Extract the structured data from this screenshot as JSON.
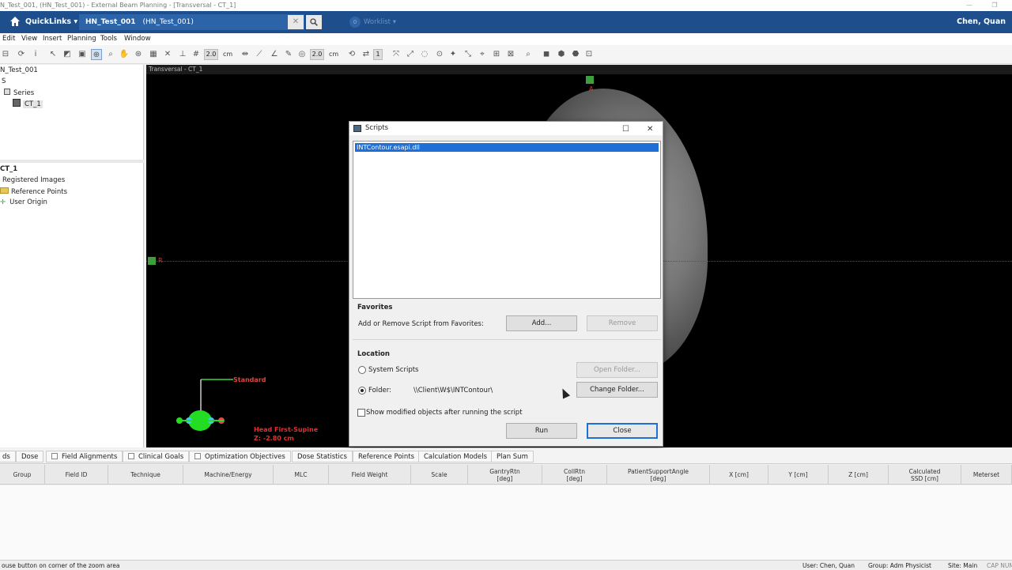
{
  "window": {
    "title": "N_Test_001, (HN_Test_001) - External Beam Planning - [Transversal - CT_1]",
    "controls": [
      "—",
      "❐"
    ]
  },
  "appbar": {
    "quicklinks": "QuickLinks ▾",
    "patient_tab_bold": "HN_Test_001",
    "patient_tab_sub": "(HN_Test_001)",
    "close_glyph": "✕",
    "search_glyph": "🔍",
    "worklist_count": "0",
    "worklist_label": "Worklist ▾",
    "user": "Chen, Quan"
  },
  "menu": [
    "Edit",
    "View",
    "Insert",
    "Planning",
    "Tools",
    "Window"
  ],
  "toolbar": {
    "field1": "2.0",
    "unit1": "cm",
    "field2": "2.0",
    "unit2": "cm",
    "field3": "1"
  },
  "left_panel": {
    "top_items": [
      "N_Test_001",
      "S",
      "Series",
      "CT_1"
    ],
    "bottom_items": [
      "CT_1",
      "Registered Images",
      "Reference Points",
      "User Origin"
    ]
  },
  "viewer": {
    "header": "Transversal - CT_1",
    "label_a": "A",
    "label_r": "R",
    "standard": "Standard",
    "head_first": "Head First-Supine",
    "z_value": "Z: -2.80 cm"
  },
  "dialog": {
    "title": "Scripts",
    "selected_script": "INTContour.esapi.dll",
    "favorites_title": "Favorites",
    "favorites_label": "Add or Remove Script from Favorites:",
    "add_button": "Add...",
    "remove_button": "Remove",
    "location_title": "Location",
    "system_scripts": "System Scripts",
    "open_folder": "Open Folder...",
    "folder_label": "Folder:",
    "folder_path": "\\\\Client\\W$\\INTContour\\",
    "change_folder": "Change Folder...",
    "show_modified": "Show modified objects after running the script",
    "run": "Run",
    "close": "Close"
  },
  "bottom_tabs": [
    {
      "label": "ds",
      "check": false
    },
    {
      "label": "Dose",
      "check": false
    },
    {
      "label": "Field Alignments",
      "check": true
    },
    {
      "label": "Clinical Goals",
      "check": true
    },
    {
      "label": "Optimization Objectives",
      "check": true
    },
    {
      "label": "Dose Statistics",
      "check": false
    },
    {
      "label": "Reference Points",
      "check": false
    },
    {
      "label": "Calculation Models",
      "check": false
    },
    {
      "label": "Plan Sum",
      "check": false
    }
  ],
  "grid_columns": [
    "Group",
    "Field ID",
    "Technique",
    "Machine/Energy",
    "MLC",
    "Field Weight",
    "Scale",
    "GantryRtn\n[deg]",
    "CollRtn\n[deg]",
    "PatientSupportAngle\n[deg]",
    "X [cm]",
    "Y [cm]",
    "Z [cm]",
    "Calculated\nSSD [cm]",
    "Meterset"
  ],
  "status": {
    "hint": "ouse button on corner of the zoom area",
    "user": "User: Chen, Quan",
    "group": "Group: Adm Physicist",
    "site": "Site: Main",
    "caps": "CAP NUM"
  }
}
